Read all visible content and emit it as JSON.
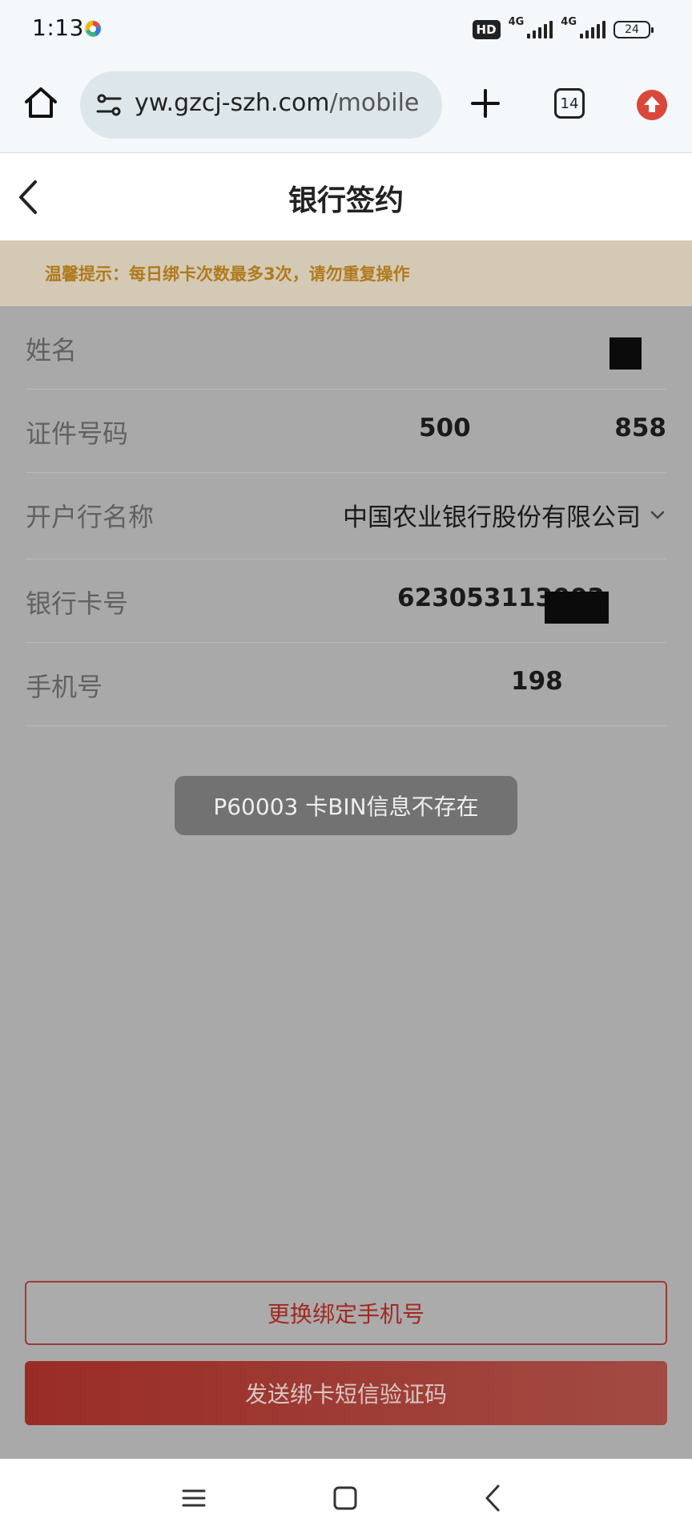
{
  "status_bar": {
    "time": "1:13",
    "hd_badge": "HD",
    "network_1": "4G",
    "network_2": "4G",
    "battery": "24"
  },
  "browser": {
    "url_main": "yw.gzcj-szh.com",
    "url_path": "/mobile",
    "tab_count": "14"
  },
  "page": {
    "title": "银行签约",
    "notice": "温馨提示：每日绑卡次数最多3次，请勿重复操作"
  },
  "form": {
    "name_label": "姓名",
    "id_label": "证件号码",
    "id_value_start": "500",
    "id_value_end": "858",
    "bank_label": "开户行名称",
    "bank_value": "中国农业银行股份有限公司",
    "card_label": "银行卡号",
    "card_value_start": "623053113003",
    "phone_label": "手机号",
    "phone_value_start": "198"
  },
  "toast": {
    "message": "P60003 卡BIN信息不存在"
  },
  "buttons": {
    "change_phone": "更换绑定手机号",
    "send_sms": "发送绑卡短信验证码"
  },
  "colors": {
    "accent_red": "#a12a22",
    "notice_text": "#b07a1c",
    "overlay_gray": "#a9a9a9"
  }
}
